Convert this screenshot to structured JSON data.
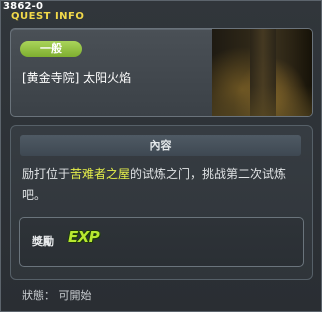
{
  "window": {
    "quest_id": "3862-0",
    "title": "QUEST INFO"
  },
  "header": {
    "badge": "一般",
    "quest_name": "[黄金寺院] 太阳火焰"
  },
  "content": {
    "section_title": "內容",
    "description_before": "励打位于",
    "description_highlight": "苦难者之屋",
    "description_after": "的试炼之门，挑战第二次试炼吧。",
    "colors": {
      "highlight": "#e6f04a",
      "badge": "#8fbf3e"
    }
  },
  "reward": {
    "label": "獎勵",
    "icon": "exp-icon",
    "icon_text": "EXP"
  },
  "status": {
    "text": "狀態： 可開始"
  }
}
